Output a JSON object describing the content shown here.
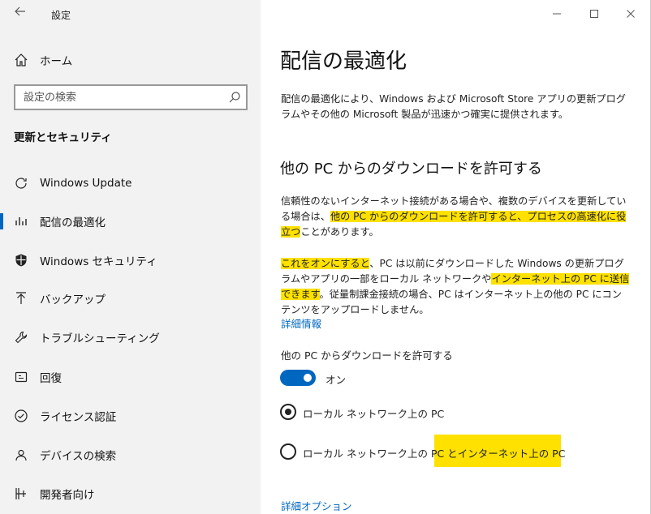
{
  "window": {
    "title": "設定",
    "back_icon": "back-arrow-icon",
    "controls": [
      "minimize-icon",
      "maximize-icon",
      "close-icon"
    ]
  },
  "sidebar": {
    "home": "ホーム",
    "search_placeholder": "設定の検索",
    "section": "更新とセキュリティ",
    "items": [
      {
        "label": "Windows Update",
        "icon": "refresh-icon"
      },
      {
        "label": "配信の最適化",
        "icon": "delivery-optimization-icon",
        "active": true
      },
      {
        "label": "Windows セキュリティ",
        "icon": "shield-icon"
      },
      {
        "label": "バックアップ",
        "icon": "backup-icon"
      },
      {
        "label": "トラブルシューティング",
        "icon": "wrench-icon"
      },
      {
        "label": "回復",
        "icon": "recovery-icon"
      },
      {
        "label": "ライセンス認証",
        "icon": "check-circle-icon"
      },
      {
        "label": "デバイスの検索",
        "icon": "person-location-icon"
      },
      {
        "label": "開発者向け",
        "icon": "developer-icon"
      }
    ]
  },
  "main": {
    "title": "配信の最適化",
    "intro": "配信の最適化により、Windows および Microsoft Store アプリの更新プログラムやその他の Microsoft 製品が迅速かつ確実に提供されます。",
    "heading": "他の PC からのダウンロードを許可する",
    "p1_a": "信頼性のないインターネット接続がある場合や、複数のデバイスを更新している場合は、",
    "p1_hl": "他の PC からのダウンロードを許可すると、プロセスの高速化に役立つ",
    "p1_b": "ことがあります。",
    "p2_hl1": "これをオンにすると",
    "p2_a": "、PC は以前にダウンロードした Windows の更新プログラムやアプリの一部をローカル ネットワークや",
    "p2_hl2": "インターネット上の PC に送信できます",
    "p2_b": "。従量制課金接続の場合、PC はインターネット上の他の PC にコンテンツをアップロードしません。",
    "details_link": "詳細情報",
    "toggle_label": "他の PC からダウンロードを許可する",
    "toggle_state": "オン",
    "toggle_on": true,
    "radio1": "ローカル ネットワーク上の PC",
    "radio2_a": "ローカル ネットワーク上の PC と",
    "radio2_b": "インターネット上の PC",
    "selected_radio": 1,
    "advanced_link": "詳細オプション"
  },
  "colors": {
    "accent": "#0067c0",
    "highlight": "#ffe100",
    "sidebar_bg": "#f2f2f2"
  }
}
